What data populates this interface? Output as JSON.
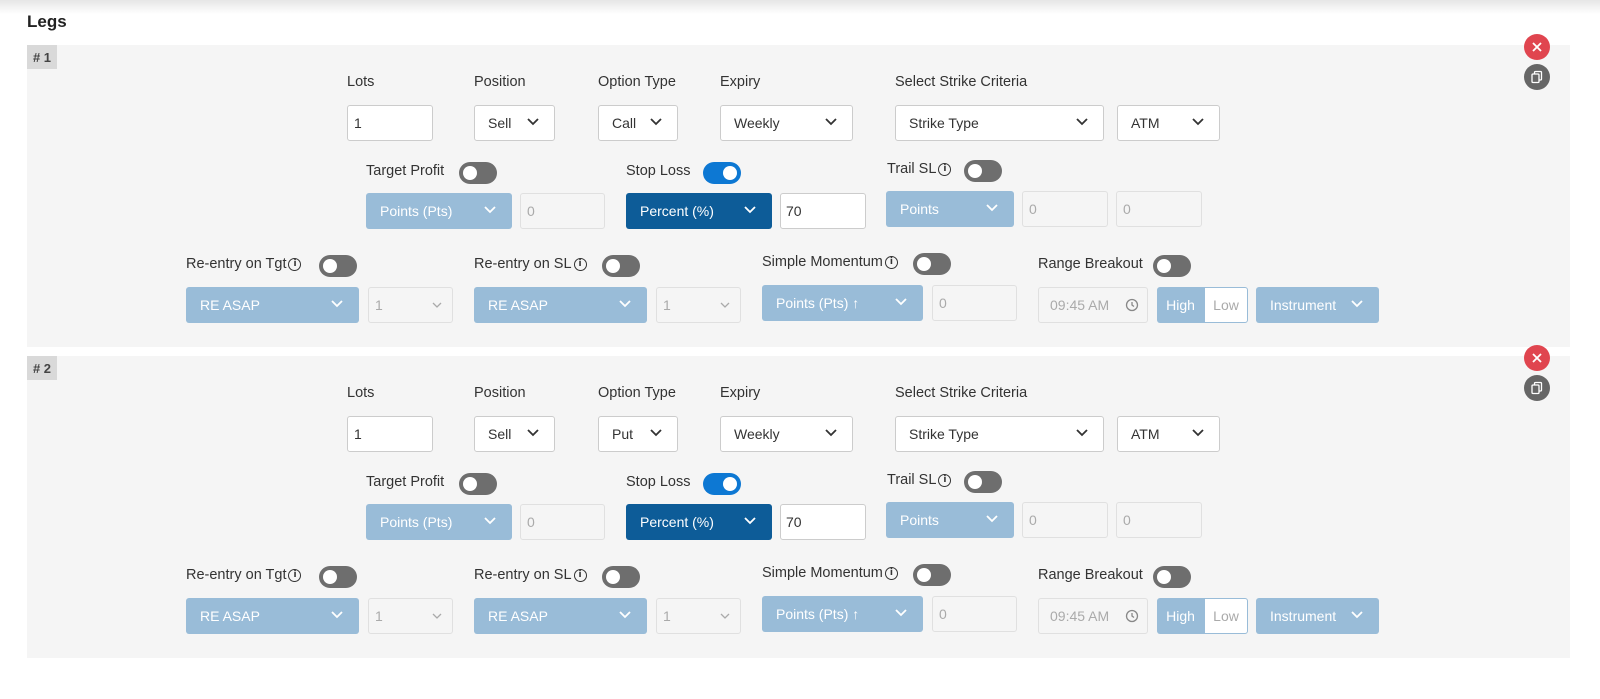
{
  "page": {
    "title": "Legs"
  },
  "labels": {
    "lots": "Lots",
    "position": "Position",
    "option_type": "Option Type",
    "expiry": "Expiry",
    "strike_criteria": "Select Strike Criteria",
    "target_profit": "Target Profit",
    "stop_loss": "Stop Loss",
    "trail_sl": "Trail SL",
    "reentry_tgt": "Re-entry on Tgt",
    "reentry_sl": "Re-entry on SL",
    "simple_momentum": "Simple Momentum",
    "range_breakout": "Range Breakout",
    "info_glyph": "i"
  },
  "legs": [
    {
      "badge": "# 1",
      "lots": "1",
      "position": "Sell",
      "option_type": "Call",
      "expiry": "Weekly",
      "strike_type": "Strike Type",
      "strike_value": "ATM",
      "target_profit": {
        "enabled": false,
        "mode": "Points (Pts)",
        "value": "0"
      },
      "stop_loss": {
        "enabled": true,
        "mode": "Percent (%)",
        "value": "70"
      },
      "trail_sl": {
        "enabled": false,
        "mode": "Points",
        "value1": "0",
        "value2": "0"
      },
      "reentry_tgt": {
        "enabled": false,
        "mode": "RE ASAP",
        "count": "1"
      },
      "reentry_sl": {
        "enabled": false,
        "mode": "RE ASAP",
        "count": "1"
      },
      "simple_momentum": {
        "enabled": false,
        "mode": "Points (Pts) ↑",
        "value": "0"
      },
      "range_breakout": {
        "enabled": false,
        "time": "09:45 AM",
        "high": "High",
        "low": "Low",
        "source": "Instrument"
      }
    },
    {
      "badge": "# 2",
      "lots": "1",
      "position": "Sell",
      "option_type": "Put",
      "expiry": "Weekly",
      "strike_type": "Strike Type",
      "strike_value": "ATM",
      "target_profit": {
        "enabled": false,
        "mode": "Points (Pts)",
        "value": "0"
      },
      "stop_loss": {
        "enabled": true,
        "mode": "Percent (%)",
        "value": "70"
      },
      "trail_sl": {
        "enabled": false,
        "mode": "Points",
        "value1": "0",
        "value2": "0"
      },
      "reentry_tgt": {
        "enabled": false,
        "mode": "RE ASAP",
        "count": "1"
      },
      "reentry_sl": {
        "enabled": false,
        "mode": "RE ASAP",
        "count": "1"
      },
      "simple_momentum": {
        "enabled": false,
        "mode": "Points (Pts) ↑",
        "value": "0"
      },
      "range_breakout": {
        "enabled": false,
        "time": "09:45 AM",
        "high": "High",
        "low": "Low",
        "source": "Instrument"
      }
    }
  ],
  "colors": {
    "toggle_on": "#0d78d3",
    "toggle_off": "#6e6e6e",
    "button_light": "#99bcd8",
    "button_dark": "#0d5c98",
    "delete": "#e0454f"
  },
  "icons": [
    "close-icon",
    "copy-icon",
    "chevron-down-icon",
    "info-icon",
    "clock-icon"
  ]
}
